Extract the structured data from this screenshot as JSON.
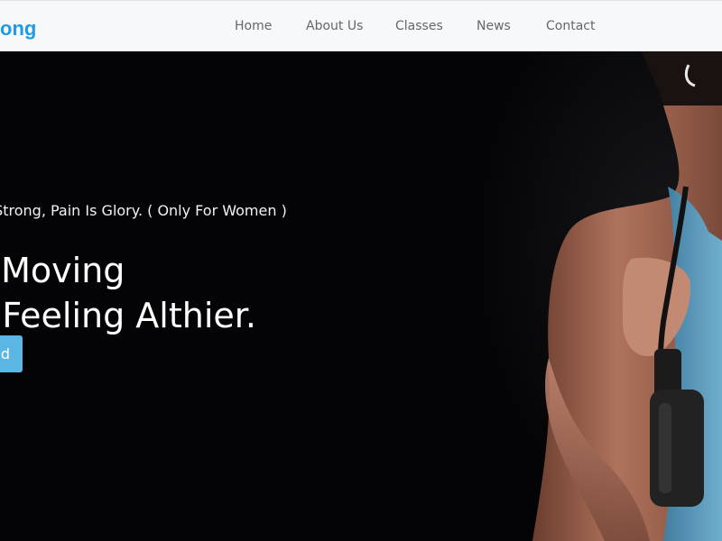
{
  "header": {
    "brand": "ong",
    "nav": [
      {
        "label": "Home"
      },
      {
        "label": "About Us"
      },
      {
        "label": "Classes"
      },
      {
        "label": "News"
      },
      {
        "label": "Contact"
      }
    ]
  },
  "hero": {
    "tagline": "rd, Play Strong, Pain Is Glory. ( Only For Women )",
    "headline_line1": "tions For Moving",
    "headline_line2": "er And Feeling Althier.",
    "cta_label": "d"
  },
  "colors": {
    "brand": "#1e9be8",
    "cta": "#5bb6e4",
    "hero_bg": "#040406",
    "top_bg": "#2d2e33",
    "tank_top": "#5aa3c6"
  }
}
